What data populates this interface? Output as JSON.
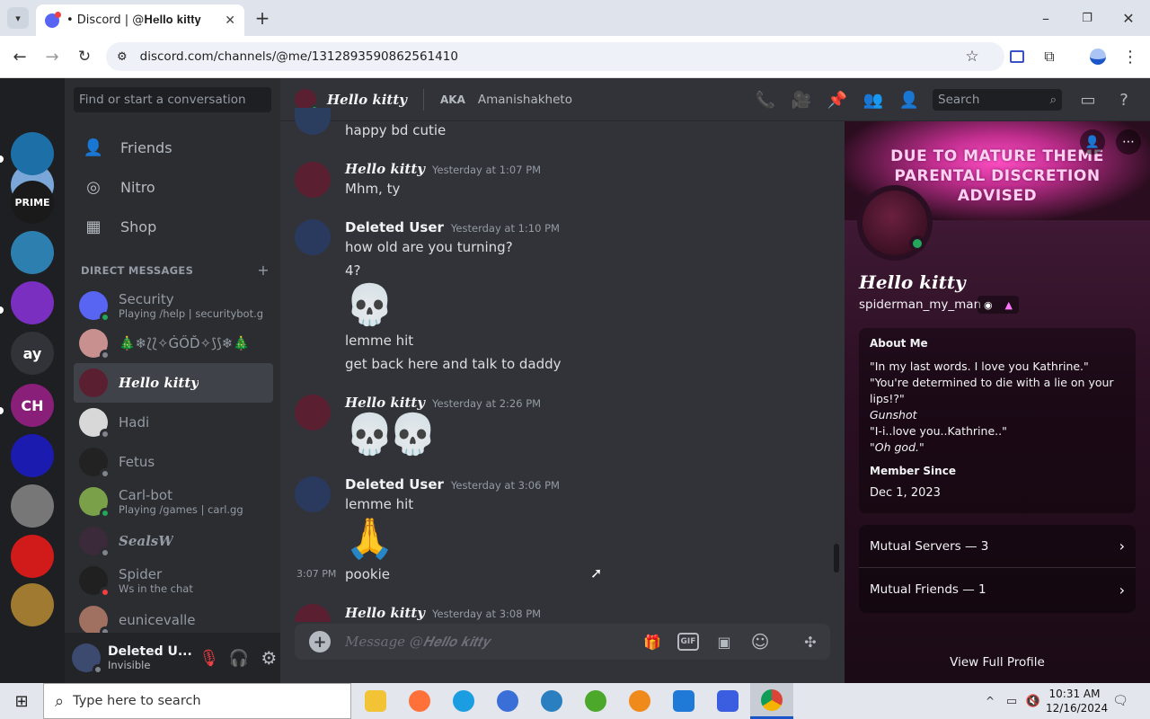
{
  "browser": {
    "tab_title": "• Discord | @𝐇𝐞𝐥𝐥𝐨 𝐤𝐢𝐭𝐭𝐲",
    "url": "discord.com/channels/@me/1312893590862561410"
  },
  "servers": [
    {
      "label": "",
      "color": "#7aa7d8"
    },
    {
      "label": "",
      "color": "#1d6fa8"
    },
    {
      "label": "PRIME",
      "color": "#1a1a1a"
    },
    {
      "label": "",
      "color": "#2d7fb0"
    },
    {
      "label": "",
      "color": "#7b2fc0"
    },
    {
      "label": "ay",
      "color": "#313338"
    },
    {
      "label": "CH",
      "color": "#8a1f7a"
    },
    {
      "label": "",
      "color": "#1b1bb0"
    },
    {
      "label": "",
      "color": "#777777"
    },
    {
      "label": "",
      "color": "#d11a1a"
    },
    {
      "label": "",
      "color": "#a07a30"
    }
  ],
  "sidebar": {
    "search_placeholder": "Find or start a conversation",
    "nav": [
      {
        "label": "Friends",
        "icon": "friends-icon"
      },
      {
        "label": "Nitro",
        "icon": "nitro-icon"
      },
      {
        "label": "Shop",
        "icon": "shop-icon"
      }
    ],
    "dm_header": "DIRECT MESSAGES",
    "dm_add": "+",
    "dms": [
      {
        "name": "Security",
        "sub": "Playing /help | securitybot.gg",
        "status": "#23a55a",
        "avatar": "#5865f2"
      },
      {
        "name": "🎄❄⟅⟅✧ĠŐĎ✧⟆⟆❄🎄",
        "sub": "",
        "status": "#80848e",
        "avatar": "#c99090"
      },
      {
        "name": "𝑯𝒆𝒍𝒍𝒐 𝒌𝒊𝒕𝒕𝒚",
        "sub": "",
        "status": "",
        "avatar": "#5a1f30",
        "selected": true
      },
      {
        "name": "Hadi",
        "sub": "",
        "status": "#80848e",
        "avatar": "#d8d8d8"
      },
      {
        "name": "Fetus",
        "sub": "",
        "status": "#80848e",
        "avatar": "#222222"
      },
      {
        "name": "Carl-bot",
        "sub": "Playing /games | carl.gg",
        "status": "#23a55a",
        "avatar": "#7aa04a"
      },
      {
        "name": "𝑺𝒆𝒂𝒍𝒔𝑾",
        "sub": "",
        "status": "#80848e",
        "avatar": "#3a2a3a"
      },
      {
        "name": "Spider",
        "sub": "Ws in the chat",
        "status": "#f23f43",
        "avatar": "#202020"
      },
      {
        "name": "eunicevalle",
        "sub": "",
        "status": "#80848e",
        "avatar": "#a07060"
      }
    ],
    "user": {
      "name": "Deleted U...",
      "status": "Invisible"
    }
  },
  "chat": {
    "header_name": "𝑯𝒆𝒍𝒍𝒐 𝒌𝒊𝒕𝒕𝒚",
    "aka_label": "AKA",
    "aka_value": "Amanishakheto",
    "search_placeholder": "Search",
    "top_line": "happy bd cutie",
    "messages": [
      {
        "author": "𝑯𝒆𝒍𝒍𝒐 𝒌𝒊𝒕𝒕𝒚",
        "time": "Yesterday at 1:07 PM",
        "lines": [
          "Mhm, ty"
        ]
      },
      {
        "author": "Deleted User",
        "time": "Yesterday at 1:10 PM",
        "lines": [
          "how old are you turning?",
          "4?",
          "lemme hit",
          "get back here and talk to daddy"
        ]
      },
      {
        "author": "𝑯𝒆𝒍𝒍𝒐 𝒌𝒊𝒕𝒕𝒚",
        "time": "Yesterday at 2:26 PM",
        "lines": []
      },
      {
        "author": "Deleted User",
        "time": "Yesterday at 3:06 PM",
        "lines": [
          "lemme hit",
          "pookie"
        ]
      },
      {
        "author": "𝑯𝒆𝒍𝒍𝒐 𝒌𝒊𝒕𝒕𝒚",
        "time": "Yesterday at 3:08 PM",
        "lines": []
      }
    ],
    "inline_time": "3:07 PM",
    "input_placeholder": "Message @𝑯𝒆𝒍𝒍𝒐 𝒌𝒊𝒕𝒕𝒚"
  },
  "profile": {
    "banner_lines": [
      "DUE TO MATURE THEME",
      "PARENTAL DISCRETION",
      "ADVISED"
    ],
    "display_name": "𝑯𝒆𝒍𝒍𝒐 𝒌𝒊𝒕𝒕𝒚",
    "username": "spiderman_my_man",
    "about_title": "About Me",
    "about_lines": [
      "\"In my last words. I love you Kathrine.\"",
      "\"You're determined to die with a lie on your",
      "lips!?\"",
      "Gunshot",
      "\"I-i..love you..Kathrine..\"",
      "\"Oh god.\""
    ],
    "member_since_title": "Member Since",
    "member_since": "Dec 1, 2023",
    "mutual_servers": "Mutual Servers — 3",
    "mutual_friends": "Mutual Friends — 1",
    "view_full": "View Full Profile"
  },
  "taskbar": {
    "search_placeholder": "Type here to search",
    "time": "10:31 AM",
    "date": "12/16/2024"
  }
}
